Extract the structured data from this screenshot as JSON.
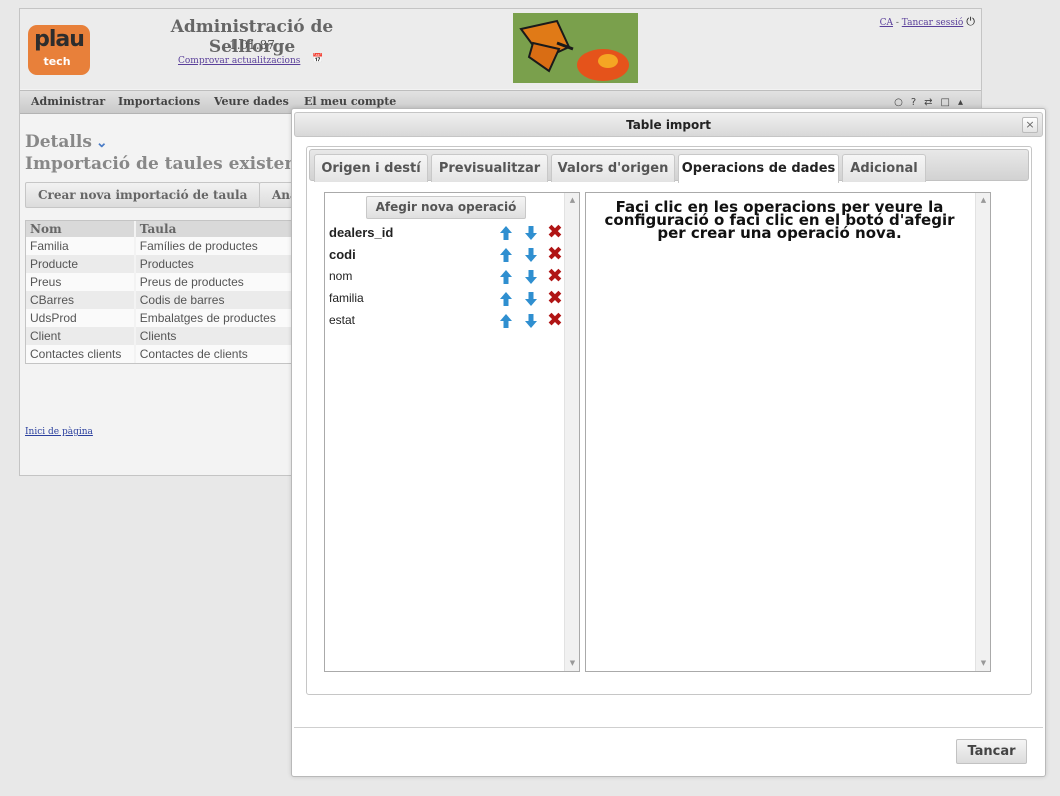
{
  "header": {
    "logo": {
      "main": "plau",
      "sub": "tech"
    },
    "title": "Administració de Sellforge",
    "version": "1.01.87",
    "check_updates": "Comprovar actualitzacions",
    "lang": "CA",
    "separator": " - ",
    "logout": "Tancar sessió"
  },
  "menu": {
    "items": [
      "Administrar",
      "Importacions",
      "Veure dades",
      "El meu compte"
    ]
  },
  "page": {
    "details": "Detalls",
    "subtitle": "Importació de taules existents",
    "buttons": [
      "Crear nova importació de taula",
      "Ana"
    ],
    "table": {
      "columns": [
        "Nom",
        "Taula"
      ],
      "rows": [
        [
          "Familia",
          "Famílies de productes"
        ],
        [
          "Producte",
          "Productes"
        ],
        [
          "Preus",
          "Preus de productes"
        ],
        [
          "CBarres",
          "Codis de barres"
        ],
        [
          "UdsProd",
          "Embalatges de productes"
        ],
        [
          "Client",
          "Clients"
        ],
        [
          "Contactes clients",
          "Contactes de clients"
        ]
      ]
    },
    "top_of_page": "Inici de pàgina"
  },
  "dialog": {
    "title": "Table import",
    "close_icon": "×",
    "tabs": [
      "Origen i destí",
      "Previsualitzar",
      "Valors d'origen",
      "Operacions de dades",
      "Adicional"
    ],
    "active_tab": "Operacions de dades",
    "add_operation": "Afegir nova operació",
    "operations": [
      {
        "name": "dealers_id",
        "bold": true
      },
      {
        "name": "codi",
        "bold": true
      },
      {
        "name": "nom",
        "bold": false
      },
      {
        "name": "familia",
        "bold": false
      },
      {
        "name": "estat",
        "bold": false
      }
    ],
    "config_message": "Faci clic en les operacions per veure la configuració o faci clic en el botó d'afegir per crear una operació nova.",
    "close_button": "Tancar"
  },
  "colors": {
    "accent_blue": "#2f8fd0",
    "delete_red": "#b01515",
    "logo_orange": "#e8803a"
  }
}
